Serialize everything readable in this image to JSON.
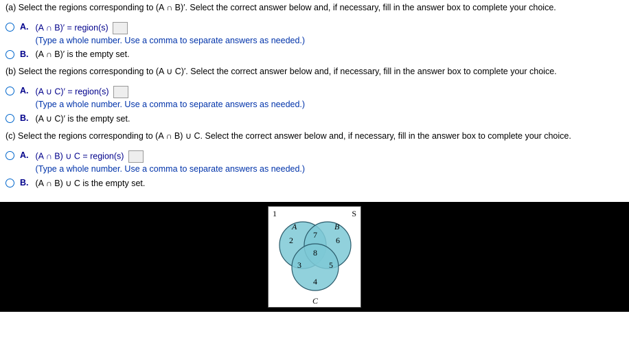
{
  "part_a": {
    "question": "(a) Select the regions corresponding to (A ∩ B)′. Select the correct answer below and, if necessary, fill in the answer box to complete your choice.",
    "option_a_label": "A.",
    "option_a_text": "(A ∩ B)′ = region(s)",
    "option_a_help": "(Type a whole number. Use a comma to separate answers as needed.)",
    "option_b_label": "B.",
    "option_b_text": "(A ∩ B)′ is the empty set."
  },
  "part_b": {
    "question": "(b) Select the regions corresponding to (A ∪ C)′. Select the correct answer below and, if necessary, fill in the answer box to complete your choice.",
    "option_a_label": "A.",
    "option_a_text": "(A ∪ C)′ = region(s)",
    "option_a_help": "(Type a whole number. Use a comma to separate answers as needed.)",
    "option_b_label": "B.",
    "option_b_text": "(A ∪ C)′ is the empty set."
  },
  "part_c": {
    "question": "(c) Select the regions corresponding to (A ∩ B) ∪ C. Select the correct answer below and, if necessary, fill in the answer box to complete your choice.",
    "option_a_label": "A.",
    "option_a_text": "(A ∩ B) ∪ C = region(s)",
    "option_a_help": "(Type a whole number. Use a comma to separate answers as needed.)",
    "option_b_label": "B.",
    "option_b_text": "(A ∩ B) ∪ C is the empty set."
  },
  "venn": {
    "labels": {
      "s": "S",
      "a": "A",
      "b": "B",
      "c": "C"
    },
    "regions": {
      "r1": "1",
      "r2": "2",
      "r3": "3",
      "r4": "4",
      "r5": "5",
      "r6": "6",
      "r7": "7",
      "r8": "8"
    }
  },
  "chart_data": {
    "type": "venn",
    "universe_label": "S",
    "sets": [
      "A",
      "B",
      "C"
    ],
    "regions": [
      {
        "id": 1,
        "sets": [],
        "description": "outside A,B,C"
      },
      {
        "id": 2,
        "sets": [
          "A"
        ],
        "description": "A only"
      },
      {
        "id": 3,
        "sets": [
          "A",
          "C"
        ],
        "description": "A∩C only"
      },
      {
        "id": 4,
        "sets": [
          "C"
        ],
        "description": "C only"
      },
      {
        "id": 5,
        "sets": [
          "B",
          "C"
        ],
        "description": "B∩C only"
      },
      {
        "id": 6,
        "sets": [
          "B"
        ],
        "description": "B only"
      },
      {
        "id": 7,
        "sets": [
          "A",
          "B"
        ],
        "description": "A∩B only"
      },
      {
        "id": 8,
        "sets": [
          "A",
          "B",
          "C"
        ],
        "description": "A∩B∩C"
      }
    ]
  }
}
